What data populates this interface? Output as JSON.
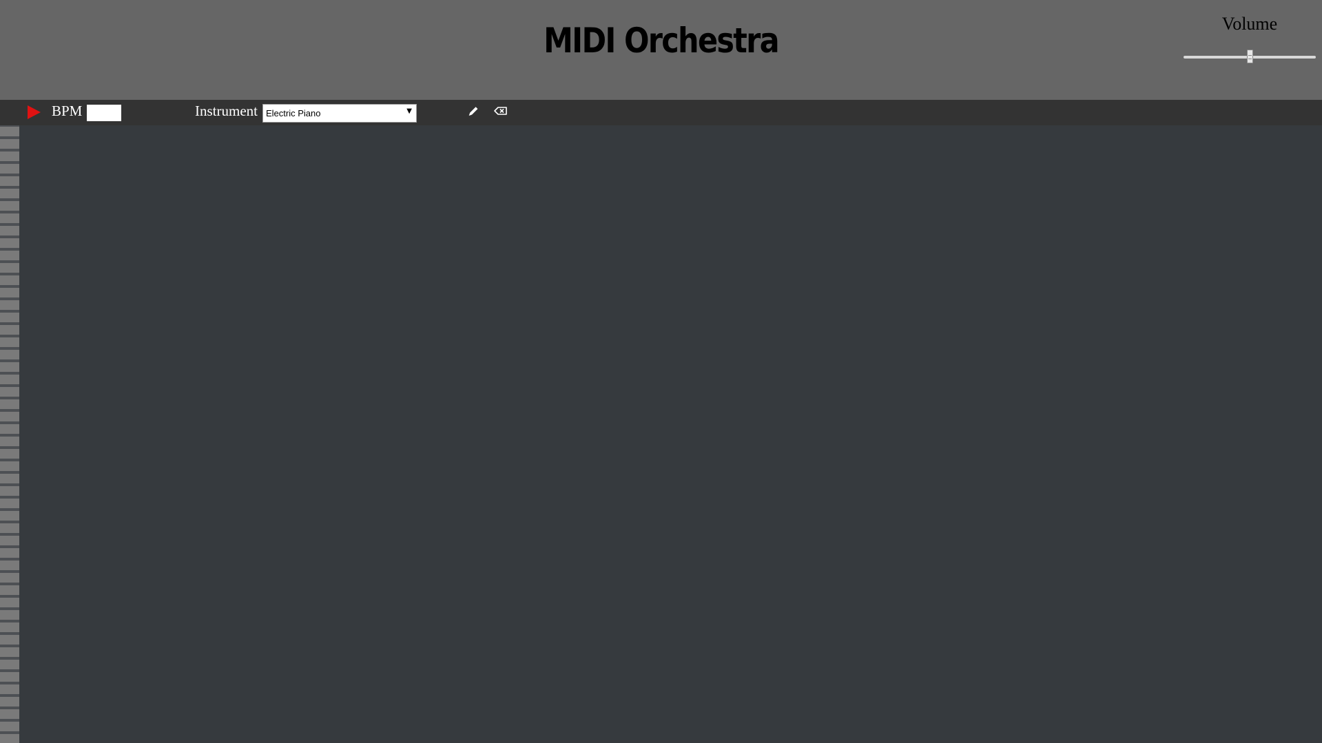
{
  "header": {
    "title": "MIDI Orchestra",
    "volume": {
      "label": "Volume",
      "value_fraction": 0.5
    }
  },
  "toolbar": {
    "play_icon": "play-icon",
    "bpm_label": "BPM",
    "bpm_value": "",
    "instrument_label": "Instrument",
    "instrument_selected": "Electric Piano",
    "pencil_icon": "pencil-icon",
    "eraser_icon": "eraser-icon"
  },
  "colors": {
    "header_bg": "#666666",
    "toolbar_bg": "#333333",
    "grid_bg": "#363a3e",
    "play_accent": "#e01212"
  }
}
